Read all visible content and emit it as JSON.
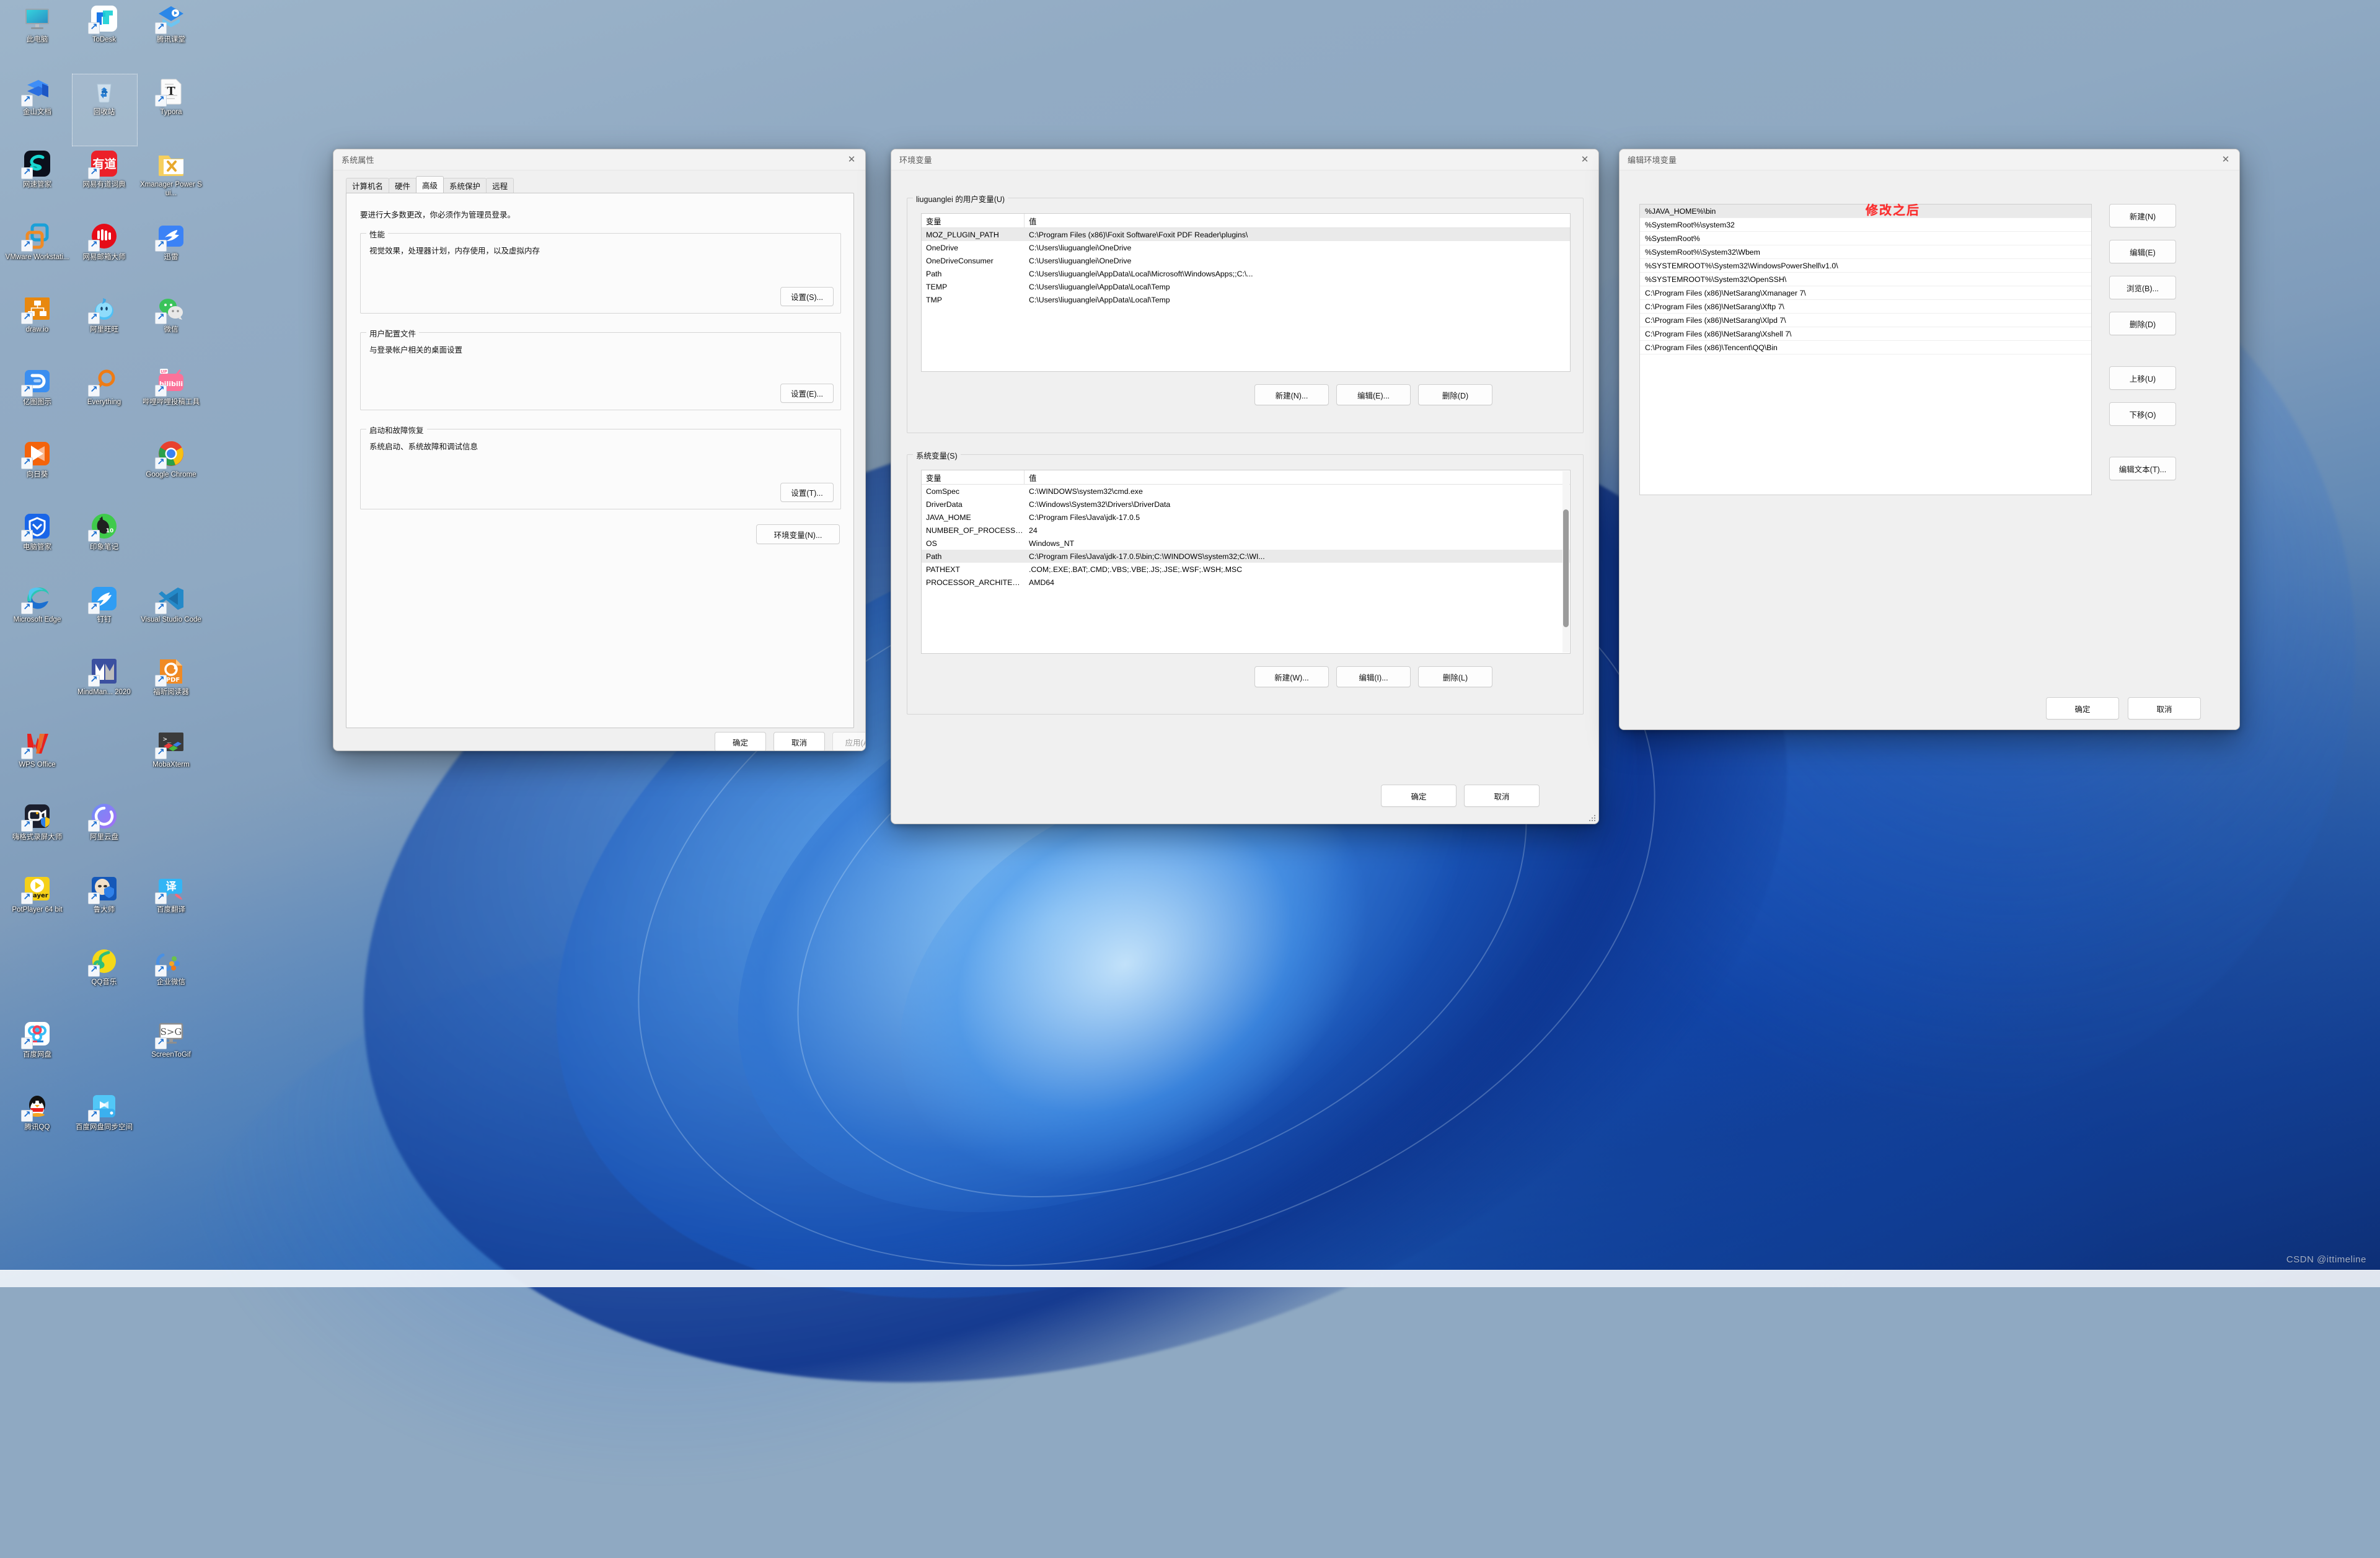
{
  "desktop": {
    "watermark": "CSDN @ittimeline",
    "icons": [
      {
        "label": "此电脑",
        "icon": "this-pc-icon",
        "shortcut": false,
        "selected": false
      },
      {
        "label": "ToDesk",
        "icon": "todesk-icon",
        "shortcut": true,
        "selected": false
      },
      {
        "label": "腾讯课堂",
        "icon": "tencent-classroom-icon",
        "shortcut": true,
        "selected": false
      },
      {
        "label": "金山文档",
        "icon": "kingsoft-docs-icon",
        "shortcut": true,
        "selected": false
      },
      {
        "label": "回收站",
        "icon": "recycle-bin-icon",
        "shortcut": false,
        "selected": true
      },
      {
        "label": "Typora",
        "icon": "typora-icon",
        "shortcut": true,
        "selected": false
      },
      {
        "label": "网速管家",
        "icon": "netspeed-manager-icon",
        "shortcut": true,
        "selected": false
      },
      {
        "label": "网易有道词典",
        "icon": "youdao-dict-icon",
        "shortcut": true,
        "selected": false
      },
      {
        "label": "Xmanager Power Sui...",
        "icon": "xmanager-icon",
        "shortcut": false,
        "selected": false
      },
      {
        "label": "VMware Workstati...",
        "icon": "vmware-icon",
        "shortcut": true,
        "selected": false
      },
      {
        "label": "网易邮箱大师",
        "icon": "netease-mail-icon",
        "shortcut": true,
        "selected": false
      },
      {
        "label": "迅雷",
        "icon": "thunder-icon",
        "shortcut": true,
        "selected": false
      },
      {
        "label": "draw.io",
        "icon": "drawio-icon",
        "shortcut": true,
        "selected": false
      },
      {
        "label": "阿里旺旺",
        "icon": "aliwangwang-icon",
        "shortcut": true,
        "selected": false
      },
      {
        "label": "微信",
        "icon": "wechat-icon",
        "shortcut": true,
        "selected": false
      },
      {
        "label": "亿图图示",
        "icon": "edraw-icon",
        "shortcut": true,
        "selected": false
      },
      {
        "label": "Everything",
        "icon": "everything-icon",
        "shortcut": true,
        "selected": false
      },
      {
        "label": "哔哩哔哩投稿工具",
        "icon": "bilibili-upload-icon",
        "shortcut": true,
        "selected": false
      },
      {
        "label": "向日葵",
        "icon": "sunflower-icon",
        "shortcut": true,
        "selected": false
      },
      {
        "label": "",
        "icon": "empty-slot",
        "shortcut": false,
        "selected": false
      },
      {
        "label": "Google Chrome",
        "icon": "chrome-icon",
        "shortcut": true,
        "selected": false
      },
      {
        "label": "电脑管家",
        "icon": "pc-manager-icon",
        "shortcut": true,
        "selected": false
      },
      {
        "label": "印象笔记",
        "icon": "evernote-icon",
        "shortcut": true,
        "selected": false
      },
      {
        "label": "",
        "icon": "empty-slot",
        "shortcut": false,
        "selected": false
      },
      {
        "label": "Microsoft Edge",
        "icon": "edge-icon",
        "shortcut": true,
        "selected": false
      },
      {
        "label": "钉钉",
        "icon": "dingtalk-icon",
        "shortcut": true,
        "selected": false
      },
      {
        "label": "Visual Studio Code",
        "icon": "vscode-icon",
        "shortcut": true,
        "selected": false
      },
      {
        "label": "",
        "icon": "empty-slot",
        "shortcut": false,
        "selected": false
      },
      {
        "label": "MindMan... 2020",
        "icon": "mindmanager-icon",
        "shortcut": true,
        "selected": false
      },
      {
        "label": "福昕阅读器",
        "icon": "foxit-reader-icon",
        "shortcut": true,
        "selected": false
      },
      {
        "label": "WPS Office",
        "icon": "wps-office-icon",
        "shortcut": true,
        "selected": false
      },
      {
        "label": "",
        "icon": "empty-slot",
        "shortcut": false,
        "selected": false
      },
      {
        "label": "MobaXterm",
        "icon": "mobaxterm-icon",
        "shortcut": true,
        "selected": false
      },
      {
        "label": "嗨格式录屏大师",
        "icon": "higeshi-recorder-icon",
        "shortcut": true,
        "selected": false
      },
      {
        "label": "阿里云盘",
        "icon": "aliyun-drive-icon",
        "shortcut": true,
        "selected": false
      },
      {
        "label": "",
        "icon": "empty-slot",
        "shortcut": false,
        "selected": false
      },
      {
        "label": "PotPlayer 64 bit",
        "icon": "potplayer-icon",
        "shortcut": true,
        "selected": false
      },
      {
        "label": "鲁大师",
        "icon": "ludashi-icon",
        "shortcut": true,
        "selected": false
      },
      {
        "label": "百度翻译",
        "icon": "baidu-translate-icon",
        "shortcut": true,
        "selected": false
      },
      {
        "label": "",
        "icon": "empty-slot",
        "shortcut": false,
        "selected": false
      },
      {
        "label": "QQ音乐",
        "icon": "qq-music-icon",
        "shortcut": true,
        "selected": false
      },
      {
        "label": "企业微信",
        "icon": "wecom-icon",
        "shortcut": true,
        "selected": false
      },
      {
        "label": "百度网盘",
        "icon": "baidu-netdisk-icon",
        "shortcut": true,
        "selected": false
      },
      {
        "label": "",
        "icon": "empty-slot",
        "shortcut": false,
        "selected": false
      },
      {
        "label": "ScreenToGif",
        "icon": "screentogif-icon",
        "shortcut": true,
        "selected": false
      },
      {
        "label": "腾讯QQ",
        "icon": "tencent-qq-icon",
        "shortcut": true,
        "selected": false
      },
      {
        "label": "百度网盘同步空间",
        "icon": "baidu-netdisk-sync-icon",
        "shortcut": true,
        "selected": false
      }
    ]
  },
  "system_properties": {
    "title": "系统属性",
    "close_label": "✕",
    "tabs": [
      {
        "label": "计算机名",
        "active": false
      },
      {
        "label": "硬件",
        "active": false
      },
      {
        "label": "高级",
        "active": true
      },
      {
        "label": "系统保护",
        "active": false
      },
      {
        "label": "远程",
        "active": false
      }
    ],
    "notice": "要进行大多数更改，你必须作为管理员登录。",
    "groups": [
      {
        "title": "性能",
        "desc": "视觉效果，处理器计划，内存使用，以及虚拟内存",
        "button": "设置(S)..."
      },
      {
        "title": "用户配置文件",
        "desc": "与登录帐户相关的桌面设置",
        "button": "设置(E)..."
      },
      {
        "title": "启动和故障恢复",
        "desc": "系统启动、系统故障和调试信息",
        "button": "设置(T)..."
      }
    ],
    "env_button": "环境变量(N)...",
    "footer": {
      "ok": "确定",
      "cancel": "取消",
      "apply": "应用(A)"
    }
  },
  "environment_variables": {
    "title": "环境变量",
    "close_label": "✕",
    "user_section": {
      "title": "liuguanglei 的用户变量(U)",
      "columns": [
        "变量",
        "值"
      ],
      "rows": [
        {
          "name": "MOZ_PLUGIN_PATH",
          "value": "C:\\Program Files (x86)\\Foxit Software\\Foxit PDF Reader\\plugins\\",
          "selected": true
        },
        {
          "name": "OneDrive",
          "value": "C:\\Users\\liuguanglei\\OneDrive",
          "selected": false
        },
        {
          "name": "OneDriveConsumer",
          "value": "C:\\Users\\liuguanglei\\OneDrive",
          "selected": false
        },
        {
          "name": "Path",
          "value": "C:\\Users\\liuguanglei\\AppData\\Local\\Microsoft\\WindowsApps;;C:\\...",
          "selected": false
        },
        {
          "name": "TEMP",
          "value": "C:\\Users\\liuguanglei\\AppData\\Local\\Temp",
          "selected": false
        },
        {
          "name": "TMP",
          "value": "C:\\Users\\liuguanglei\\AppData\\Local\\Temp",
          "selected": false
        }
      ],
      "buttons": {
        "new": "新建(N)...",
        "edit": "编辑(E)...",
        "delete": "删除(D)"
      }
    },
    "system_section": {
      "title": "系统变量(S)",
      "columns": [
        "变量",
        "值"
      ],
      "rows": [
        {
          "name": "ComSpec",
          "value": "C:\\WINDOWS\\system32\\cmd.exe",
          "selected": false
        },
        {
          "name": "DriverData",
          "value": "C:\\Windows\\System32\\Drivers\\DriverData",
          "selected": false
        },
        {
          "name": "JAVA_HOME",
          "value": "C:\\Program Files\\Java\\jdk-17.0.5",
          "selected": false
        },
        {
          "name": "NUMBER_OF_PROCESSORS",
          "value": "24",
          "selected": false
        },
        {
          "name": "OS",
          "value": "Windows_NT",
          "selected": false
        },
        {
          "name": "Path",
          "value": "C:\\Program Files\\Java\\jdk-17.0.5\\bin;C:\\WINDOWS\\system32;C:\\WI...",
          "selected": true
        },
        {
          "name": "PATHEXT",
          "value": ".COM;.EXE;.BAT;.CMD;.VBS;.VBE;.JS;.JSE;.WSF;.WSH;.MSC",
          "selected": false
        },
        {
          "name": "PROCESSOR_ARCHITECTURE",
          "value": "AMD64",
          "selected": false
        }
      ],
      "buttons": {
        "new": "新建(W)...",
        "edit": "编辑(I)...",
        "delete": "删除(L)"
      }
    },
    "footer": {
      "ok": "确定",
      "cancel": "取消"
    }
  },
  "edit_environment_variable": {
    "title": "编辑环境变量",
    "close_label": "✕",
    "annotation": "修改之后",
    "annotation_color": "#fb2c2c",
    "entries": [
      {
        "value": "%JAVA_HOME%\\bin",
        "selected": true
      },
      {
        "value": "%SystemRoot%\\system32",
        "selected": false
      },
      {
        "value": "%SystemRoot%",
        "selected": false
      },
      {
        "value": "%SystemRoot%\\System32\\Wbem",
        "selected": false
      },
      {
        "value": "%SYSTEMROOT%\\System32\\WindowsPowerShell\\v1.0\\",
        "selected": false
      },
      {
        "value": "%SYSTEMROOT%\\System32\\OpenSSH\\",
        "selected": false
      },
      {
        "value": "C:\\Program Files (x86)\\NetSarang\\Xmanager 7\\",
        "selected": false
      },
      {
        "value": "C:\\Program Files (x86)\\NetSarang\\Xftp 7\\",
        "selected": false
      },
      {
        "value": "C:\\Program Files (x86)\\NetSarang\\Xlpd 7\\",
        "selected": false
      },
      {
        "value": "C:\\Program Files (x86)\\NetSarang\\Xshell 7\\",
        "selected": false
      },
      {
        "value": "C:\\Program Files (x86)\\Tencent\\QQ\\Bin",
        "selected": false
      }
    ],
    "side_buttons": [
      {
        "label": "新建(N)",
        "name": "new-button"
      },
      {
        "label": "编辑(E)",
        "name": "edit-button"
      },
      {
        "label": "浏览(B)...",
        "name": "browse-button"
      },
      {
        "label": "删除(D)",
        "name": "delete-button"
      },
      {
        "label": "上移(U)",
        "name": "move-up-button"
      },
      {
        "label": "下移(O)",
        "name": "move-down-button"
      },
      {
        "label": "编辑文本(T)...",
        "name": "edit-text-button"
      }
    ],
    "footer": {
      "ok": "确定",
      "cancel": "取消"
    }
  }
}
